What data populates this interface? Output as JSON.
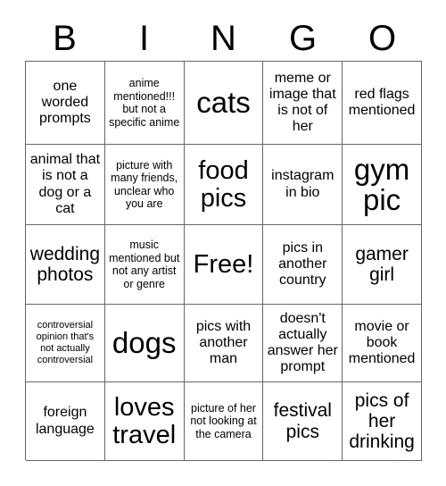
{
  "card": {
    "header_letters": [
      "B",
      "I",
      "N",
      "G",
      "O"
    ],
    "rows": [
      [
        {
          "text": "one worded prompts",
          "size": "m"
        },
        {
          "text": "anime mentioned!!! but not a specific anime",
          "size": "s"
        },
        {
          "text": "cats",
          "size": "xxl"
        },
        {
          "text": "meme or image that is not of her",
          "size": "m"
        },
        {
          "text": "red flags mentioned",
          "size": "m"
        }
      ],
      [
        {
          "text": "animal that is not a dog or a cat",
          "size": "m"
        },
        {
          "text": "picture with many friends, unclear who you are",
          "size": "s"
        },
        {
          "text": "food pics",
          "size": "xl"
        },
        {
          "text": "instagram in bio",
          "size": "m"
        },
        {
          "text": "gym pic",
          "size": "xxl"
        }
      ],
      [
        {
          "text": "wedding photos",
          "size": "l"
        },
        {
          "text": "music mentioned but not any artist or genre",
          "size": "s"
        },
        {
          "text": "Free!",
          "size": "xl"
        },
        {
          "text": "pics in another country",
          "size": "m"
        },
        {
          "text": "gamer girl",
          "size": "l"
        }
      ],
      [
        {
          "text": "controversial opinion that's not actually controversial",
          "size": "xs"
        },
        {
          "text": "dogs",
          "size": "xxl"
        },
        {
          "text": "pics with another man",
          "size": "m"
        },
        {
          "text": "doesn't actually answer her prompt",
          "size": "m"
        },
        {
          "text": "movie or book mentioned",
          "size": "m"
        }
      ],
      [
        {
          "text": "foreign language",
          "size": "m"
        },
        {
          "text": "loves travel",
          "size": "xl"
        },
        {
          "text": "picture of her not looking at the camera",
          "size": "s"
        },
        {
          "text": "festival pics",
          "size": "l"
        },
        {
          "text": "pics of her drinking",
          "size": "l"
        }
      ]
    ]
  },
  "colors": {
    "background": "#ffffff",
    "text": "#000000",
    "grid_line": "#666666"
  }
}
